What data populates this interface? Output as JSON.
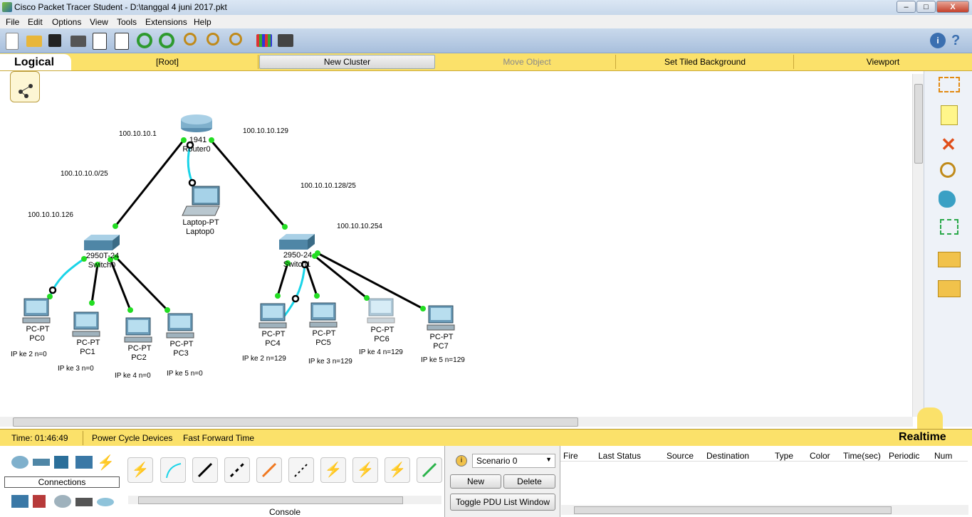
{
  "window": {
    "title": "Cisco Packet Tracer Student - D:\\tanggal 4 juni 2017.pkt",
    "min": "–",
    "max": "□",
    "close": "X"
  },
  "menu": [
    "File",
    "Edit",
    "Options",
    "View",
    "Tools",
    "Extensions",
    "Help"
  ],
  "toolbar_icons": [
    "new-icon",
    "open-icon",
    "save-icon",
    "print-icon",
    "activity-wizard-icon",
    "custom-device-icon",
    "undo-icon",
    "redo-icon",
    "zoom-in-icon",
    "zoom-reset-icon",
    "zoom-out-icon",
    "palette-icon",
    "device-template-icon",
    "info-icon",
    "help-icon"
  ],
  "logical_bar": {
    "tab": "Logical",
    "root": "[Root]",
    "new_cluster": "New Cluster",
    "move_object": "Move Object",
    "set_tiled_background": "Set Tiled Background",
    "viewport": "Viewport"
  },
  "network": {
    "labels": {
      "router_ip_left": "100.10.10.1",
      "router_ip_right": "100.10.10.129",
      "net_left": "100.10.10.0/25",
      "net_right": "100.10.10.128/25",
      "switch0_ip": "100.10.10.126",
      "switch1_ip": "100.10.10.254"
    },
    "router": {
      "model": "1941",
      "name": "Router0"
    },
    "laptop": {
      "model": "Laptop-PT",
      "name": "Laptop0"
    },
    "switch0": {
      "model": "2950T-24",
      "name": "Switch0"
    },
    "switch1": {
      "model": "2950-24",
      "name": "Switch1"
    },
    "pcs": [
      {
        "model": "PC-PT",
        "name": "PC0",
        "note": "IP ke 2 n=0"
      },
      {
        "model": "PC-PT",
        "name": "PC1",
        "note": "IP ke 3  n=0"
      },
      {
        "model": "PC-PT",
        "name": "PC2",
        "note": "IP ke 4 n=0"
      },
      {
        "model": "PC-PT",
        "name": "PC3",
        "note": "IP ke 5 n=0"
      },
      {
        "model": "PC-PT",
        "name": "PC4",
        "note": "IP ke 2 n=129"
      },
      {
        "model": "PC-PT",
        "name": "PC5",
        "note": "IP ke 3 n=129"
      },
      {
        "model": "PC-PT",
        "name": "PC6",
        "note": "IP ke 4 n=129"
      },
      {
        "model": "PC-PT",
        "name": "PC7",
        "note": "IP ke 5 n=129"
      }
    ]
  },
  "right_palette": [
    "select-icon",
    "note-icon",
    "delete-icon",
    "inspect-icon",
    "draw-shape-icon",
    "resize-icon",
    "add-simple-pdu-icon",
    "add-complex-pdu-icon"
  ],
  "status": {
    "time_label": "Time: 01:46:49",
    "power_cycle": "Power Cycle Devices",
    "fast_forward": "Fast Forward Time",
    "mode": "Realtime"
  },
  "device_panel": {
    "category_label": "Connections",
    "console_label": "Console"
  },
  "scenario": {
    "selected": "Scenario 0",
    "new": "New",
    "delete": "Delete",
    "toggle": "Toggle PDU List Window"
  },
  "pdu_columns": [
    "Fire",
    "Last Status",
    "Source",
    "Destination",
    "Type",
    "Color",
    "Time(sec)",
    "Periodic",
    "Num"
  ],
  "colors": {
    "logical_bar": "#fbe16a",
    "toolbar": "#b7cbe4",
    "link": "#000000",
    "console_link": "#19d4e8",
    "port_up": "#22dd22"
  }
}
